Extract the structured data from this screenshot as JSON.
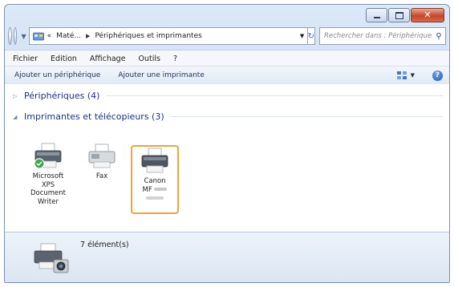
{
  "address": {
    "overflow": "«",
    "segments": [
      "Maté...",
      "Périphériques et imprimantes"
    ]
  },
  "search": {
    "placeholder": "Rechercher dans : Périphérique..."
  },
  "menu": [
    "Fichier",
    "Edition",
    "Affichage",
    "Outils",
    "?"
  ],
  "toolbar": {
    "add_device": "Ajouter un périphérique",
    "add_printer": "Ajouter une imprimante"
  },
  "groups": {
    "devices": "Périphériques (4)",
    "printers": "Imprimantes et télécopieurs (3)"
  },
  "printers": [
    {
      "label": "Microsoft XPS Document Writer",
      "default": true
    },
    {
      "label": "Fax"
    },
    {
      "label_line1": "Canon",
      "label_line2": "MF"
    }
  ],
  "details": {
    "count": "7 élément(s)"
  },
  "colors": {
    "selection": "#f0a23a",
    "group_text": "#1e3287",
    "close_button": "#c7462a"
  }
}
